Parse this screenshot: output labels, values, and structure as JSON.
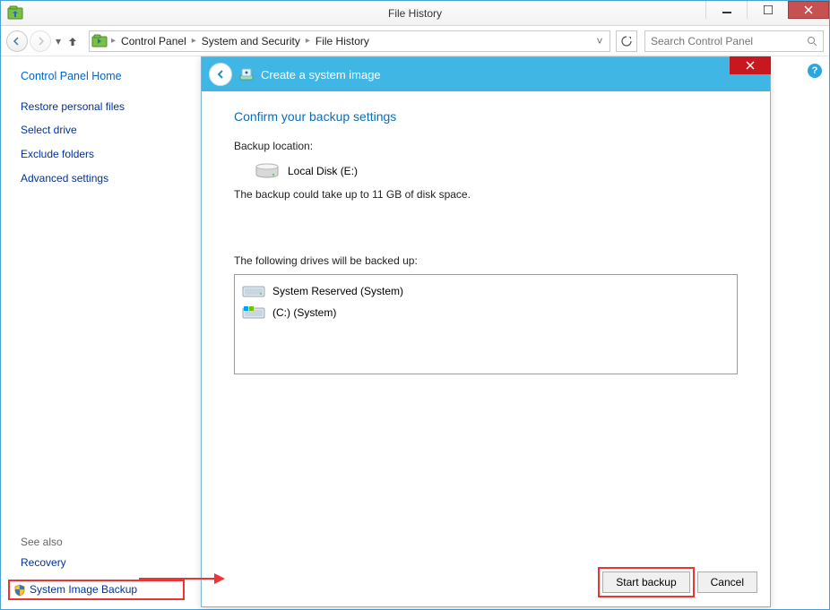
{
  "window": {
    "title": "File History"
  },
  "breadcrumb": {
    "items": [
      "Control Panel",
      "System and Security",
      "File History"
    ]
  },
  "search": {
    "placeholder": "Search Control Panel"
  },
  "sidebar": {
    "home": "Control Panel Home",
    "links": [
      "Restore personal files",
      "Select drive",
      "Exclude folders",
      "Advanced settings"
    ],
    "seealso_label": "See also",
    "seealso_links": [
      "Recovery",
      "System Image Backup"
    ]
  },
  "wizard": {
    "title": "Create a system image",
    "heading": "Confirm your backup settings",
    "location_label": "Backup location:",
    "location_value": "Local Disk (E:)",
    "note": "The backup could take up to 11 GB of disk space.",
    "drives_label": "The following drives will be backed up:",
    "drives": [
      "System Reserved (System)",
      "(C:) (System)"
    ],
    "buttons": {
      "start": "Start backup",
      "cancel": "Cancel"
    }
  }
}
